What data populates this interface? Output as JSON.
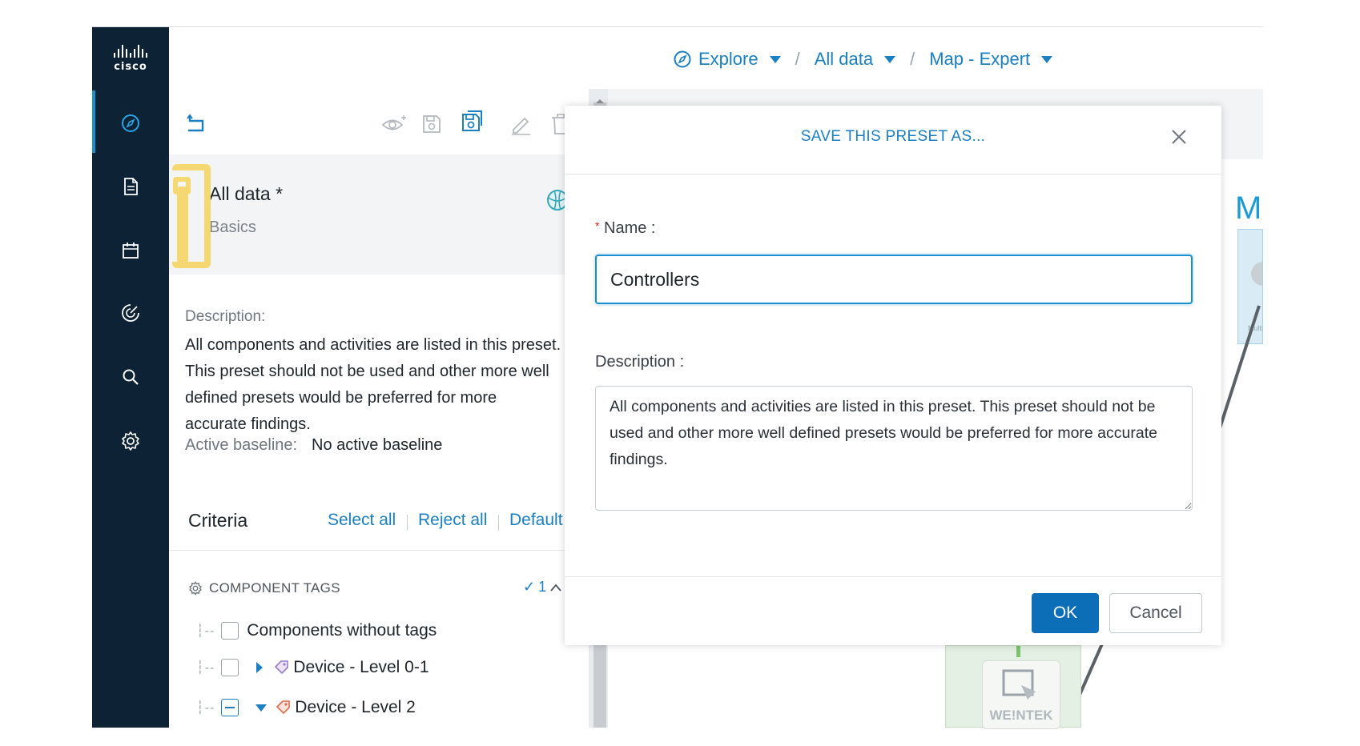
{
  "brand": {
    "logo_text": "cisco"
  },
  "sidebar": {
    "items": [
      {
        "icon": "compass-icon",
        "active": true
      },
      {
        "icon": "document-icon"
      },
      {
        "icon": "calendar-icon"
      },
      {
        "icon": "radar-icon"
      },
      {
        "icon": "search-icon"
      },
      {
        "icon": "gear-icon"
      }
    ]
  },
  "breadcrumb": {
    "explore": "Explore",
    "all_data": "All data",
    "map": "Map - Expert",
    "separator": "/"
  },
  "panel": {
    "preset_title": "All data *",
    "preset_subtitle": "Basics",
    "description_label": "Description:",
    "description_text": "All components and activities are listed in this preset. This preset should not be used and other more well defined presets would be preferred for more accurate findings.",
    "baseline_label": "Active baseline:",
    "baseline_value": "No active baseline",
    "criteria_label": "Criteria",
    "select_all": "Select all",
    "reject_all": "Reject all",
    "default": "Default",
    "component_tags_label": "COMPONENT TAGS",
    "component_tags_count": "1",
    "tree": [
      {
        "label": "Components without tags"
      },
      {
        "label": "Device - Level 0-1"
      },
      {
        "label": "Device - Level 2"
      }
    ]
  },
  "modal": {
    "title": "SAVE THIS PRESET AS...",
    "name_label": "Name :",
    "required_mark": "*",
    "name_value": "Controllers",
    "description_label": "Description :",
    "description_value": "All components and activities are listed in this preset. This preset should not be used and other more well defined presets would be preferred for more accurate findings.",
    "ok_label": "OK",
    "cancel_label": "Cancel"
  },
  "map_bg": {
    "partial_title": "Mu",
    "node_caption": "WE!NTEK",
    "small_caption": "Multi"
  },
  "colors": {
    "accent": "#1b7fc1",
    "sidebar": "#0d2234",
    "primary_button": "#0d6eb8",
    "highlight": "#f6d873"
  }
}
